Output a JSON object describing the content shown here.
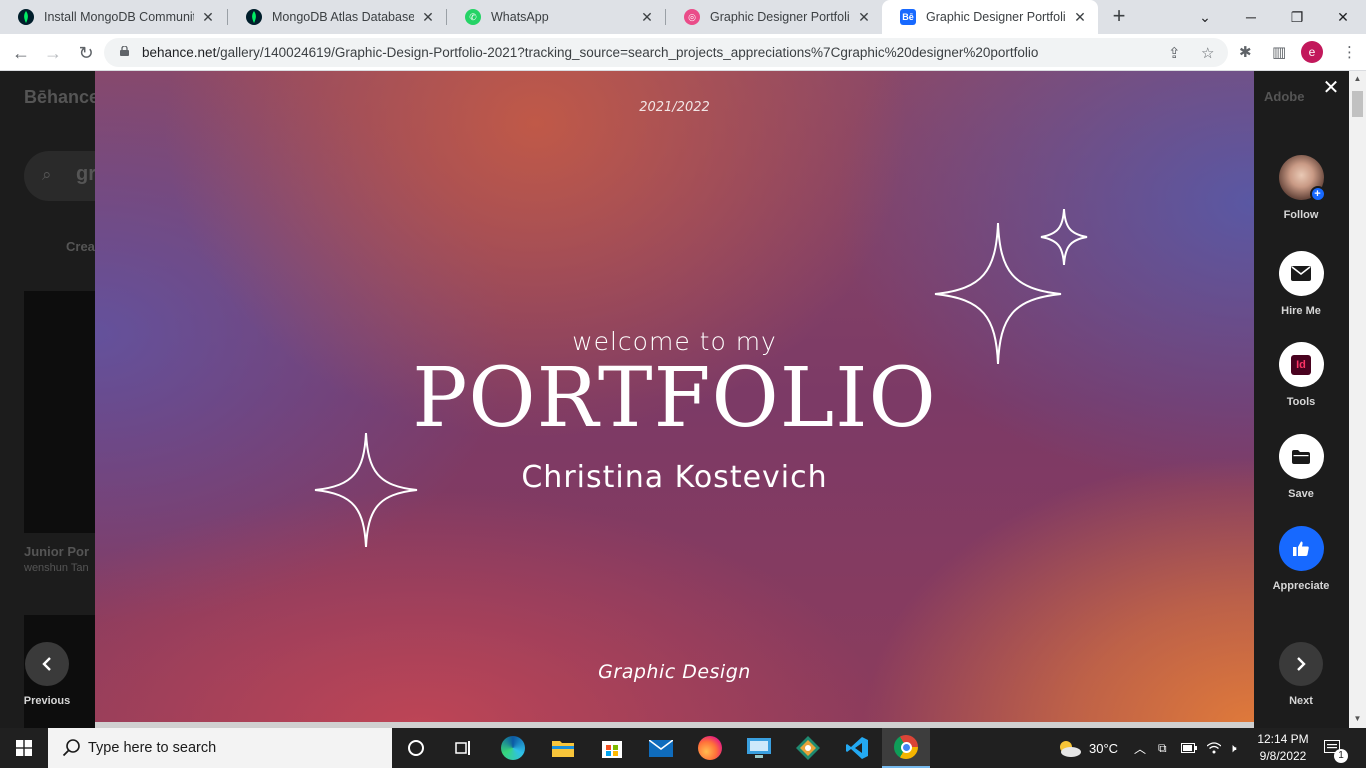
{
  "browser": {
    "tabs": [
      {
        "title": "Install MongoDB Community",
        "icon": "mongodb-leaf-icon",
        "active": false
      },
      {
        "title": "MongoDB Atlas Database | M",
        "icon": "mongodb-leaf-icon",
        "active": false
      },
      {
        "title": "WhatsApp",
        "icon": "whatsapp-icon",
        "active": false
      },
      {
        "title": "Graphic Designer Portfolio d",
        "icon": "dribbble-icon",
        "active": false
      },
      {
        "title": "Graphic Designer Portfolio P",
        "icon": "behance-icon",
        "active": true
      }
    ],
    "url_host": "behance.net",
    "url_path": "/gallery/140024619/Graphic-Design-Portfolio-2021?tracking_source=search_projects_appreciations%7Cgraphic%20designer%20portfolio",
    "profile_initial": "e"
  },
  "background_page": {
    "logo": "Bēhance",
    "adobe": "Adobe",
    "search_fragment": "gr",
    "create_fragment": "Crea",
    "card_title_fragment": "Junior Por",
    "card_author_fragment": "wenshun Tan"
  },
  "project": {
    "year": "2021/2022",
    "welcome": "welcome to my",
    "headline": "PORTFOLIO",
    "author": "Christina Kostevich",
    "footer": "Graphic Design"
  },
  "side_actions": {
    "follow": "Follow",
    "hire": "Hire Me",
    "tools": "Tools",
    "tool_badge": "Id",
    "save": "Save",
    "appreciate": "Appreciate",
    "previous": "Previous",
    "next": "Next"
  },
  "taskbar": {
    "search_placeholder": "Type here to search",
    "temperature": "30°C",
    "time": "12:14 PM",
    "date": "9/8/2022",
    "notification_count": "1"
  },
  "colors": {
    "behance_blue": "#1769ff",
    "indesign_pink": "#49021f",
    "chrome_active_tab": "#ffffff"
  }
}
